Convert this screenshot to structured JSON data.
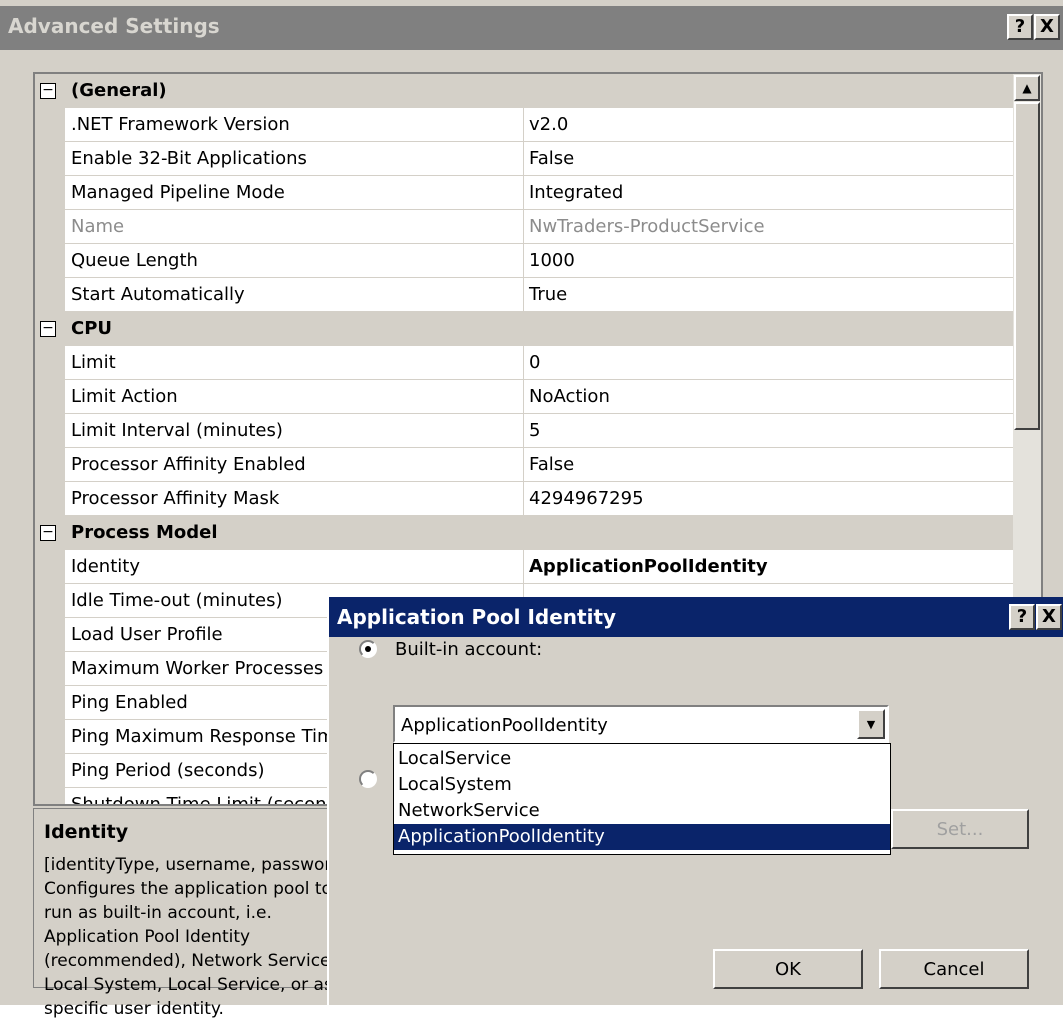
{
  "advanced_window": {
    "title": "Advanced Settings",
    "help_button": "?",
    "close_button": "X"
  },
  "property_grid": {
    "categories": [
      {
        "name": "(General)",
        "expander": "−",
        "properties": [
          {
            "name": ".NET Framework Version",
            "value": "v2.0"
          },
          {
            "name": "Enable 32-Bit Applications",
            "value": "False"
          },
          {
            "name": "Managed Pipeline Mode",
            "value": "Integrated"
          },
          {
            "name": "Name",
            "value": "NwTraders-ProductService"
          },
          {
            "name": "Queue Length",
            "value": "1000"
          },
          {
            "name": "Start Automatically",
            "value": "True"
          }
        ]
      },
      {
        "name": "CPU",
        "expander": "−",
        "properties": [
          {
            "name": "Limit",
            "value": "0"
          },
          {
            "name": "Limit Action",
            "value": "NoAction"
          },
          {
            "name": "Limit Interval (minutes)",
            "value": "5"
          },
          {
            "name": "Processor Affinity Enabled",
            "value": "False"
          },
          {
            "name": "Processor Affinity Mask",
            "value": "4294967295"
          }
        ]
      },
      {
        "name": "Process Model",
        "expander": "−",
        "properties": [
          {
            "name": "Identity",
            "value": "ApplicationPoolIdentity"
          },
          {
            "name": "Idle Time-out (minutes)",
            "value": ""
          },
          {
            "name": "Load User Profile",
            "value": ""
          },
          {
            "name": "Maximum Worker Processes",
            "value": ""
          },
          {
            "name": "Ping Enabled",
            "value": ""
          },
          {
            "name": "Ping Maximum Response Time",
            "value": ""
          },
          {
            "name": "Ping Period (seconds)",
            "value": ""
          },
          {
            "name": "Shutdown Time Limit (seconds)",
            "value": ""
          }
        ]
      }
    ]
  },
  "description": {
    "title": "Identity",
    "text": "[identityType, username, password] Configures the application pool to run as built-in account, i.e. Application Pool Identity (recommended), Network Service, Local System, Local Service, or as a specific user identity."
  },
  "identity_dialog": {
    "title": "Application Pool Identity",
    "help_button": "?",
    "close_button": "X",
    "builtin_label": "Built-in account:",
    "selected_account": "ApplicationPoolIdentity",
    "options": [
      "LocalService",
      "LocalSystem",
      "NetworkService",
      "ApplicationPoolIdentity"
    ],
    "set_button": "Set...",
    "ok_button": "OK",
    "cancel_button": "Cancel"
  },
  "colors": {
    "dialog_title_bg": "#0a246a",
    "inactive_title_bg": "#808080",
    "window_bg": "#d4d0c8",
    "selection_bg": "#0a246a"
  }
}
